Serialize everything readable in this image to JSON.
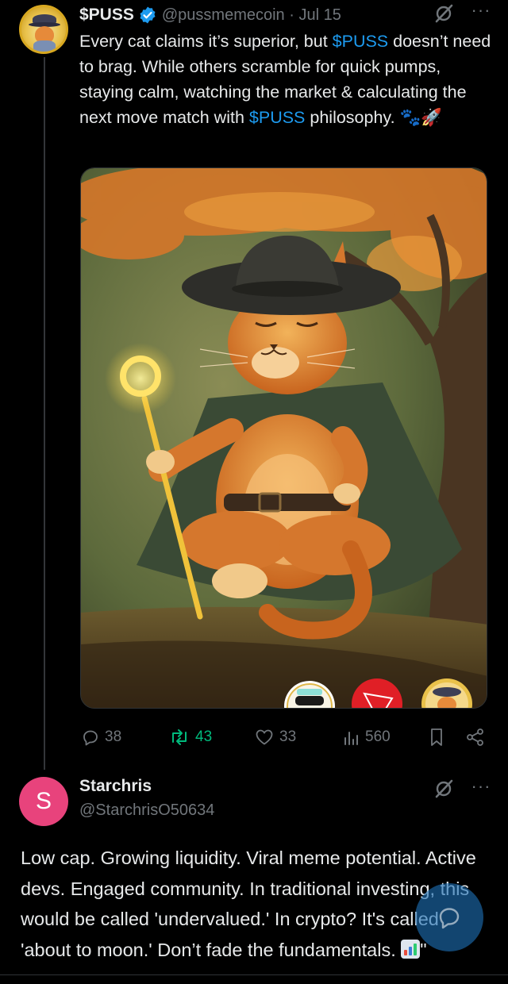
{
  "post": {
    "display_name": "$PUSS",
    "handle_date": "@pussmemecoin · Jul 15",
    "text_segments": [
      "Every cat claims it’s superior, but ",
      "$PUSS",
      " doesn’t need to brag. While others scramble for quick pumps, staying calm, watching the market & calculating the next move match with ",
      "$PUSS",
      " philosophy. 🐾🚀"
    ],
    "media_icons": [
      "sunglasses-coin-icon",
      "tron-logo-icon",
      "puss-avatar-icon"
    ],
    "stats": {
      "replies": "38",
      "reposts": "43",
      "likes": "33",
      "views": "560"
    }
  },
  "reply": {
    "avatar_letter": "S",
    "avatar_color": "#e8437c",
    "display_name": "Starchris",
    "handle": "@StarchrisO50634",
    "text": "Low cap. Growing liquidity. Viral meme potential. Active devs. Engaged community. In traditional investing, this would be called 'undervalued.' In crypto? It's called 'about to moon.' Don’t fade the fundamentals. ",
    "text_suffix": "\""
  },
  "colors": {
    "background": "#000000",
    "text": "#e7e9ea",
    "muted": "#71767b",
    "link": "#1d9bf0",
    "repost_active": "#00ba7c"
  }
}
